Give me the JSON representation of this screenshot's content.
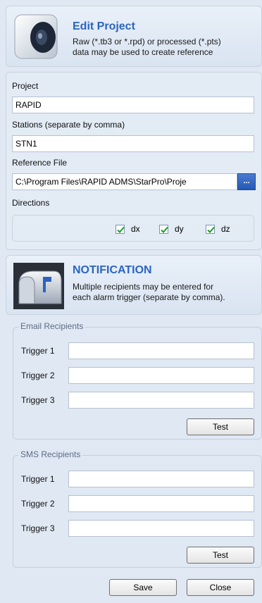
{
  "edit_project": {
    "title": "Edit Project",
    "description_line1": "Raw (*.tb3 or *.rpd) or processed (*.pts)",
    "description_line2": "data may be used to create reference",
    "icon": "speaker-icon"
  },
  "project": {
    "project_label": "Project",
    "project_value": "RAPID",
    "stations_label": "Stations (separate by comma)",
    "stations_value": "STN1",
    "reference_label": "Reference File",
    "reference_value": "C:\\Program Files\\RAPID ADMS\\StarPro\\Proje",
    "browse_label": "...",
    "directions_label": "Directions",
    "directions": [
      {
        "label": "dx",
        "checked": true
      },
      {
        "label": "dy",
        "checked": true
      },
      {
        "label": "dz",
        "checked": true
      }
    ]
  },
  "notification": {
    "title": "NOTIFICATION",
    "description_line1": "Multiple recipients may be entered for",
    "description_line2": "each alarm trigger (separate by comma).",
    "icon": "mailbox-icon"
  },
  "email": {
    "legend": "Email Recipients",
    "triggers": [
      {
        "label": "Trigger 1",
        "value": ""
      },
      {
        "label": "Trigger 2",
        "value": ""
      },
      {
        "label": "Trigger 3",
        "value": ""
      }
    ],
    "test_label": "Test"
  },
  "sms": {
    "legend": "SMS Recipients",
    "triggers": [
      {
        "label": "Trigger 1",
        "value": ""
      },
      {
        "label": "Trigger 2",
        "value": ""
      },
      {
        "label": "Trigger 3",
        "value": ""
      }
    ],
    "test_label": "Test"
  },
  "footer": {
    "save_label": "Save",
    "close_label": "Close"
  },
  "colors": {
    "accent": "#2b64c0",
    "background": "#dfe8f3",
    "browse_button": "#2458b5",
    "check": "#1e9a2a"
  }
}
